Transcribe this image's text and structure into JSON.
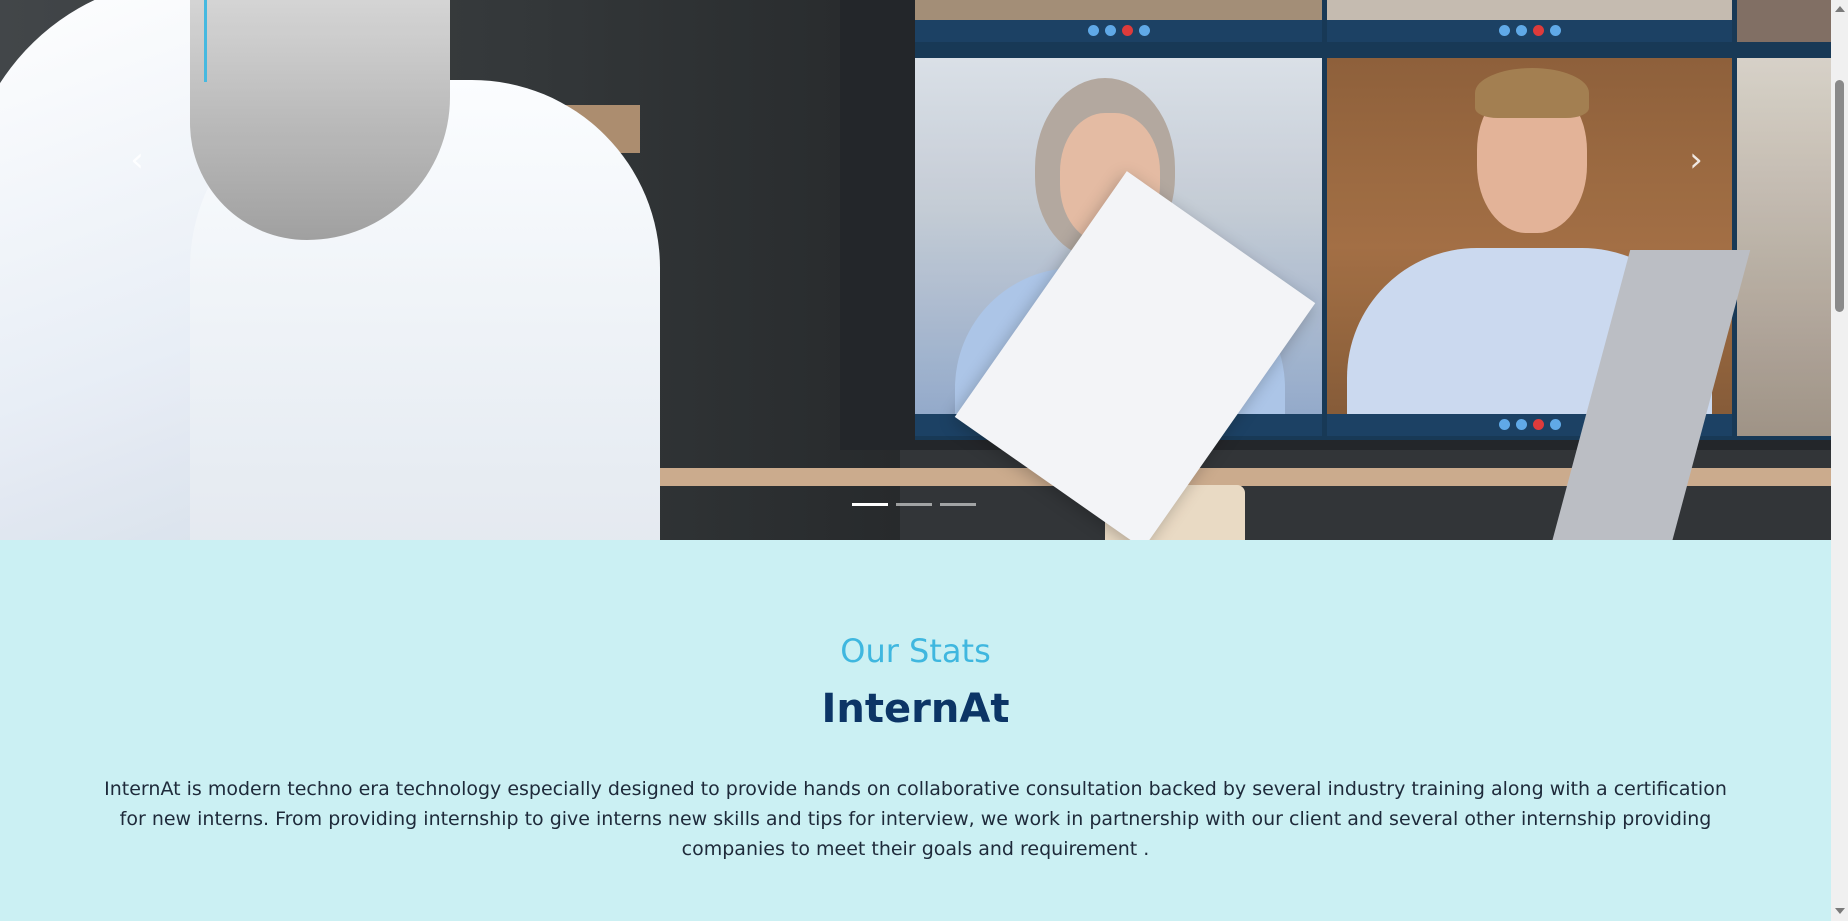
{
  "carousel": {
    "prev_icon": "chevron-left-icon",
    "next_icon": "chevron-right-icon",
    "prev_glyph": "‹",
    "next_glyph": "›",
    "slide_count": 3,
    "active_slide": 1
  },
  "stats": {
    "eyebrow": "Our Stats",
    "title": "InternAt",
    "description": "InternAt is modern techno era technology especially designed to provide hands on collaborative consultation backed by several industry training along with a certification for new interns. From providing internship to give interns new skills and tips for interview, we work in partnership with our client and several other internship providing companies to meet their goals and requirement ."
  },
  "colors": {
    "section_bg": "#cbf0f3",
    "eyebrow": "#3fb7df",
    "title": "#0c3566",
    "body_text": "#1e2a3a"
  }
}
